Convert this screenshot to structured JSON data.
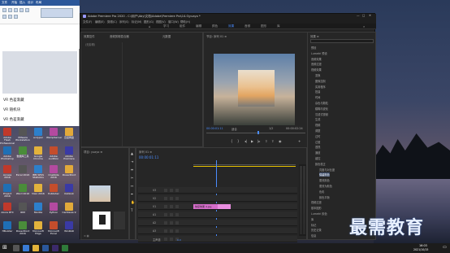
{
  "premiere": {
    "title": "Adobe Premiere Pro 2020 - C:\\用户\\Aby\\文档\\Adobe\\Premiere Pro\\14.0\\yuayo *",
    "menu": [
      "文件(F)",
      "编辑(E)",
      "剪辑(C)",
      "序列(S)",
      "标记(M)",
      "图形(G)",
      "视图(V)",
      "窗口(W)",
      "帮助(H)"
    ],
    "workspaces": [
      "学习",
      "组件",
      "编辑",
      "颜色",
      "效果",
      "音频",
      "图形",
      "库"
    ],
    "source_tabs": [
      "效果控件",
      "音频剪辑混合器",
      "元数据"
    ],
    "source_empty": "(无剪辑)",
    "program_header": "节目: 序列 01 ≡",
    "timecode_left": "00:00:01:11",
    "fit": "适合",
    "fraction": "1/2",
    "timecode_right": "00:00:02:24",
    "project_header": "项目: yuayo ≡",
    "timeline_header": "序列 01 ≡",
    "timeline_timecode": "00:00:01:11",
    "tracks": [
      "V3",
      "V2",
      "V1",
      "A1",
      "A2",
      "A3",
      "主声道"
    ],
    "clip_label": "恢复效果 4.jpg",
    "master_value": "0.0",
    "effects_header": "效果 ≡",
    "effects": [
      "预设",
      "Lumetri 预设",
      "音频效果",
      "音频过渡",
      "视频效果",
      "变换",
      "图像控制",
      "实用程序",
      "扭曲",
      "时间",
      "杂色与颗粒",
      "模糊与锐化",
      "沉浸式视频",
      "生成",
      "视频",
      "调整",
      "过时",
      "过渡",
      "透视",
      "通道",
      "键控",
      "颜色校正",
      "亮度与对比度",
      "保留颜色",
      "更改颜色",
      "更改为颜色",
      "色彩",
      "颜色平衡",
      "视频过渡",
      "基本图形",
      "Lumetri 颜色",
      "库",
      "标记",
      "历史记录",
      "信息"
    ]
  },
  "word": {
    "title": "文件",
    "tabs": [
      "开始",
      "插入",
      "设计",
      "布局",
      "引用",
      "邮件",
      "审阅",
      "视图"
    ],
    "line1": "VR 色差渐藏",
    "line2": "VR 随机块",
    "line3": "VR 色差渐藏"
  },
  "desktop_icons": [
    "Adobe Flash Professional",
    "VMware Workstation",
    "ar-typer",
    "WampServer",
    "百度网盘",
    "Adobe Photoshop",
    "数据库工具",
    "Google Chrome",
    "Adobe Audition",
    "Adobe Premiere",
    "Access 2016",
    "Excel 2016",
    "IBM SPSS Statistics",
    "OneNote 2016",
    "PowerPoint",
    "Project 2016",
    "Word 2016",
    "Visio 2016",
    "Publisher",
    "Outlook",
    "Azure RTX",
    "IDM",
    "Mozilla",
    "Python",
    "Camtasia 9",
    "HBuilder",
    "PowerPoint 2016",
    "Microsoft Edge",
    "Microsoft Excel",
    "WinRAR"
  ],
  "watermark": "最需教育",
  "clock": {
    "time": "16:03",
    "date": "2021/10/15"
  },
  "colors": {
    "accent": "#2b579a",
    "clip": "#d46cc9",
    "playhead": "#4b8dff"
  }
}
